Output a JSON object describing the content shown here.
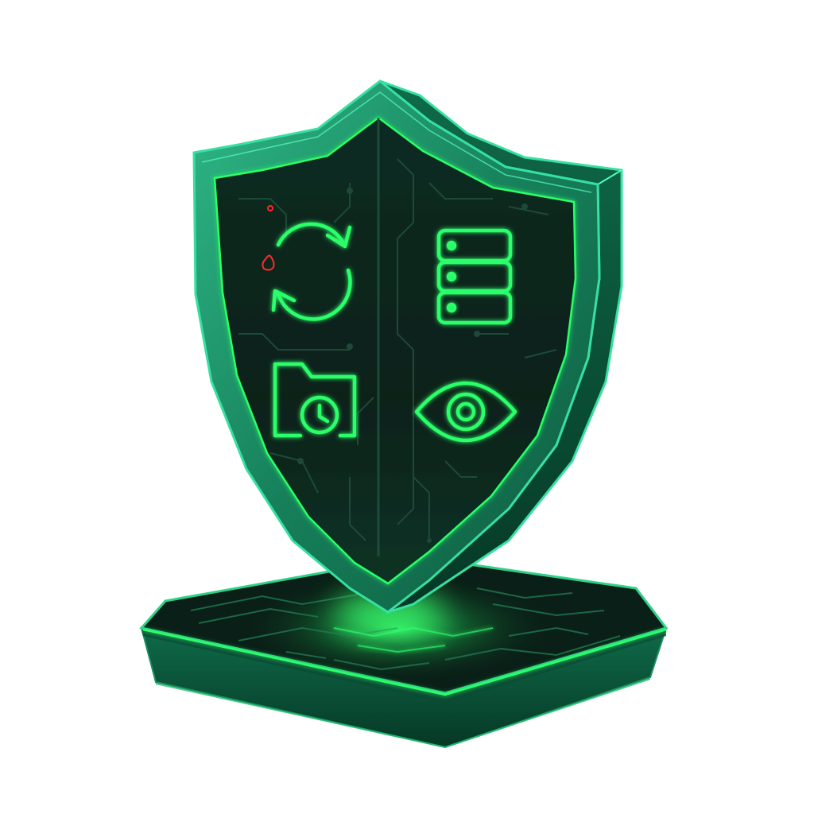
{
  "scene": {
    "subject": "glowing-security-shield-on-circuit-pedestal",
    "colors": {
      "background": "#ffffff",
      "glow_green": "#2bff6a",
      "shield_face": "#0b231b",
      "shield_rim": "#1f9b6e",
      "shield_edge": "#37e0a0",
      "pedestal_top": "#0a1f17",
      "pedestal_side": "#061811",
      "alert_red": "#ff2a2a"
    },
    "icons": [
      {
        "name": "sync-icon"
      },
      {
        "name": "server-stack-icon"
      },
      {
        "name": "folder-clock-icon"
      },
      {
        "name": "eye-icon"
      }
    ]
  }
}
